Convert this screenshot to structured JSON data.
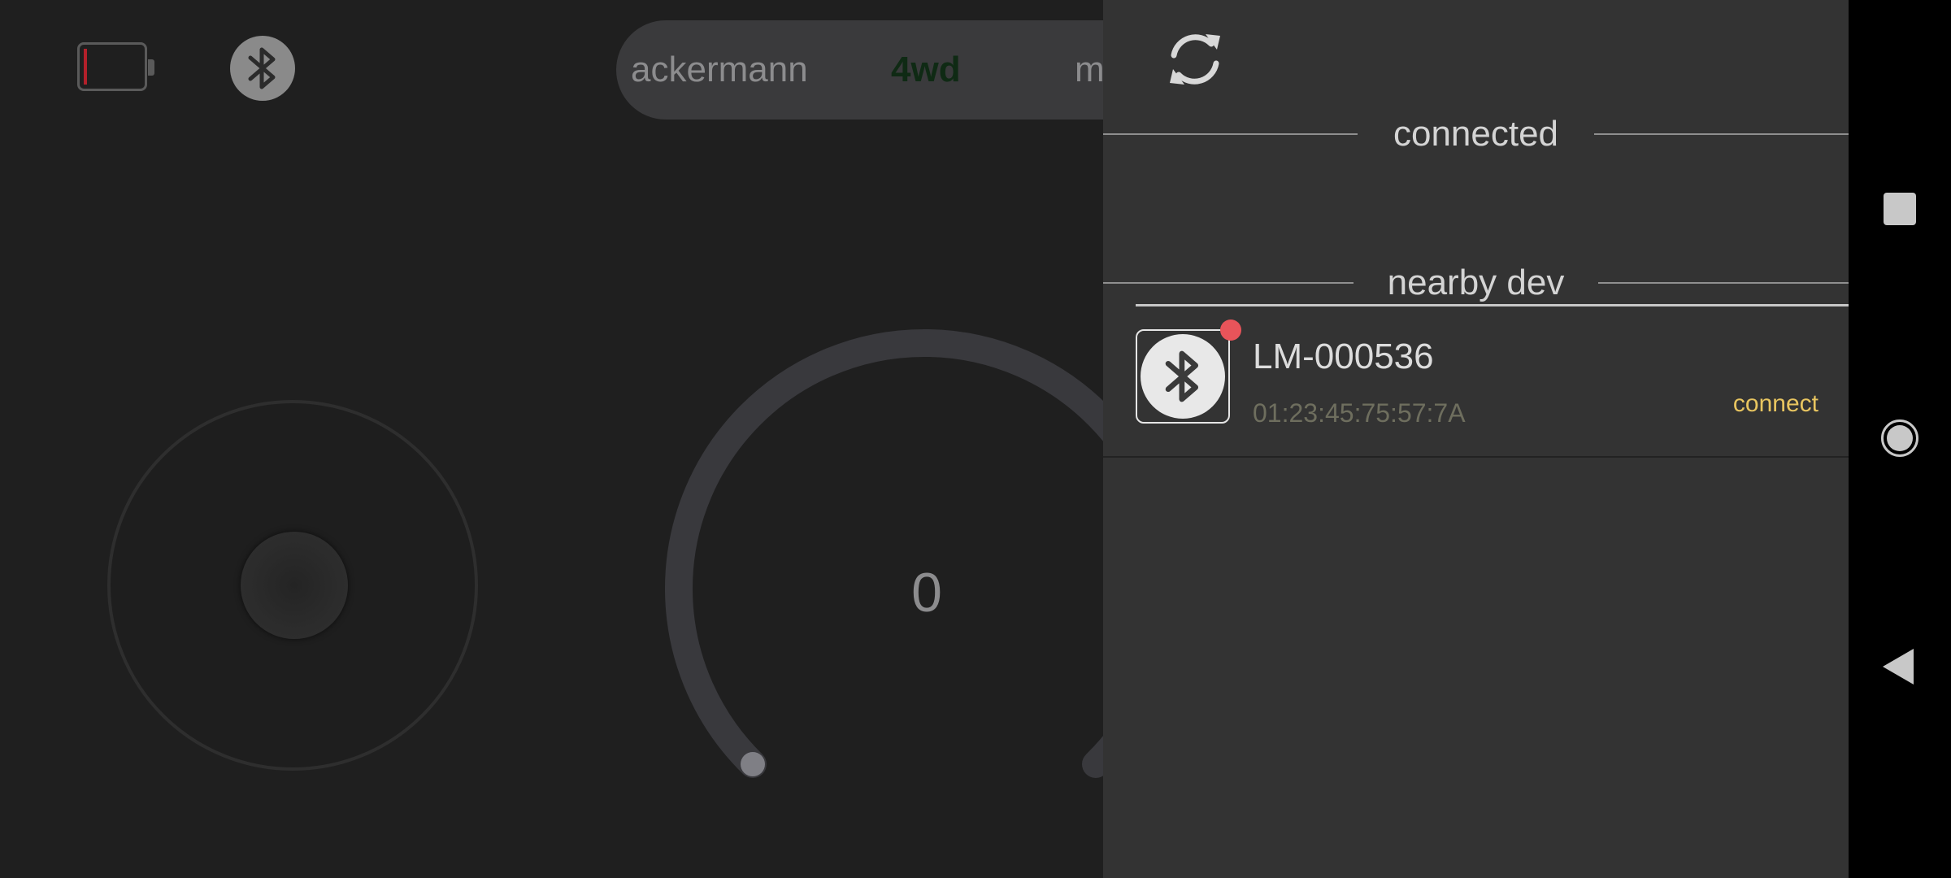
{
  "status": {
    "battery_icon": "battery-empty-icon",
    "bluetooth_icon": "bluetooth-icon"
  },
  "mode_selector": {
    "options": [
      "ackermann",
      "4wd",
      "m"
    ],
    "selected": "4wd",
    "selected_color": "#0f2a14"
  },
  "joystick": {
    "icon": "joystick"
  },
  "speed_dial": {
    "value": "0"
  },
  "drawer": {
    "refresh_icon": "refresh-icon",
    "connected_title": "connected",
    "nearby_title": "nearby dev",
    "devices": [
      {
        "name": "LM-000536",
        "mac": "01:23:45:75:57:7A",
        "action": "connect",
        "icon": "bluetooth-icon",
        "badge_color": "#e8545a"
      }
    ],
    "accent_color": "#e8c560"
  },
  "nav_bar": {
    "recents_icon": "recents-square-icon",
    "home_icon": "home-circle-icon",
    "back_icon": "back-triangle-icon"
  }
}
